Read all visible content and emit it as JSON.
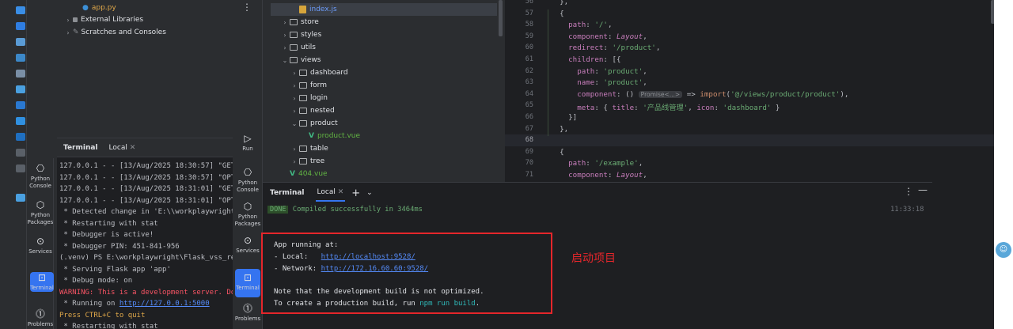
{
  "project_tree_top": {
    "app_file": "app.py",
    "external_libraries": "External Libraries",
    "scratches": "Scratches and Consoles"
  },
  "left_terminal": {
    "title": "Terminal",
    "tab": "Local",
    "lines": [
      {
        "text": "127.0.0.1 - - [13/Aug/2025 18:30:57] \"GET",
        "cls": ""
      },
      {
        "text": "127.0.0.1 - - [13/Aug/2025 18:30:57] \"OPT",
        "cls": ""
      },
      {
        "text": "127.0.0.1 - - [13/Aug/2025 18:31:01] \"GET",
        "cls": ""
      },
      {
        "text": "127.0.0.1 - - [13/Aug/2025 18:31:01] \"OPT",
        "cls": ""
      },
      {
        "text": " * Detected change in 'E:\\\\workplaywright",
        "cls": ""
      },
      {
        "text": " * Restarting with stat",
        "cls": ""
      },
      {
        "text": " * Debugger is active!",
        "cls": ""
      },
      {
        "text": " * Debugger PIN: 451-841-956",
        "cls": ""
      },
      {
        "text": "(.venv) PS E:\\workplaywright\\Flask_vss_re",
        "cls": ""
      },
      {
        "text": " * Serving Flask app 'app'",
        "cls": ""
      },
      {
        "text": " * Debug mode: on",
        "cls": ""
      },
      {
        "text": "WARNING: This is a development server. Do",
        "cls": "red"
      },
      {
        "text": " * Running on http://127.0.0.1:5000",
        "cls": ""
      },
      {
        "text": "Press CTRL+C to quit",
        "cls": "org"
      },
      {
        "text": " * Restarting with stat",
        "cls": ""
      }
    ]
  },
  "left_strip": [
    {
      "label": "Python Console",
      "icon": "python-console-icon"
    },
    {
      "label": "Python Packages",
      "icon": "packages-icon"
    },
    {
      "label": "Services",
      "icon": "services-icon"
    },
    {
      "label": "Terminal",
      "icon": "terminal-icon"
    },
    {
      "label": "Problems",
      "icon": "problems-icon"
    }
  ],
  "mid_strip": [
    {
      "label": "Run",
      "icon": "run-icon"
    },
    {
      "label": "Python Console",
      "icon": "python-console-icon"
    },
    {
      "label": "Python Packages",
      "icon": "packages-icon"
    },
    {
      "label": "Services",
      "icon": "services-icon"
    },
    {
      "label": "Terminal",
      "icon": "terminal-icon"
    },
    {
      "label": "Problems",
      "icon": "problems-icon"
    }
  ],
  "file_tree": [
    {
      "name": "index.js",
      "type": "js",
      "indent": 3,
      "arrow": "",
      "selected": true
    },
    {
      "name": "store",
      "type": "folder",
      "indent": 2,
      "arrow": "›",
      "selected": false
    },
    {
      "name": "styles",
      "type": "folder",
      "indent": 2,
      "arrow": "›",
      "selected": false
    },
    {
      "name": "utils",
      "type": "folder",
      "indent": 2,
      "arrow": "›",
      "selected": false
    },
    {
      "name": "views",
      "type": "folder",
      "indent": 2,
      "arrow": "⌄",
      "selected": false
    },
    {
      "name": "dashboard",
      "type": "folder",
      "indent": 3,
      "arrow": "›",
      "selected": false
    },
    {
      "name": "form",
      "type": "folder",
      "indent": 3,
      "arrow": "›",
      "selected": false
    },
    {
      "name": "login",
      "type": "folder",
      "indent": 3,
      "arrow": "›",
      "selected": false
    },
    {
      "name": "nested",
      "type": "folder",
      "indent": 3,
      "arrow": "›",
      "selected": false
    },
    {
      "name": "product",
      "type": "folder",
      "indent": 3,
      "arrow": "⌄",
      "selected": false
    },
    {
      "name": "product.vue",
      "type": "vue",
      "indent": 4,
      "arrow": "",
      "selected": false
    },
    {
      "name": "table",
      "type": "folder",
      "indent": 3,
      "arrow": "›",
      "selected": false
    },
    {
      "name": "tree",
      "type": "folder",
      "indent": 3,
      "arrow": "›",
      "selected": false
    },
    {
      "name": "404.vue",
      "type": "vue",
      "indent": 2,
      "arrow": "",
      "selected": false
    }
  ],
  "editor": {
    "line_numbers": [
      "56",
      "57",
      "58",
      "59",
      "60",
      "61",
      "62",
      "63",
      "64",
      "65",
      "66",
      "67",
      "68",
      "69",
      "70",
      "71"
    ],
    "lines": [
      "  },",
      "  {",
      "    path: '/',",
      "    component: Layout,",
      "    redirect: '/product',",
      "    children: [{",
      "      path: 'product',",
      "      name: 'product',",
      "      component: () ",
      "      meta: { title: '产品线管理', icon: 'dashboard' }",
      "    }]",
      "  },",
      "",
      "  {",
      "    path: '/example',",
      "    component: Layout,"
    ],
    "hint": "Promise<...>",
    "hint_after": " => import('@/views/product/product'),"
  },
  "bottom_terminal": {
    "title": "Terminal",
    "tab": "Local",
    "done_badge": "DONE",
    "compiled": "Compiled successfully in 3464ms",
    "time": "11:33:18",
    "app_running": "App running at:",
    "local_label": "- Local:   ",
    "local_url": "http://localhost:9528/",
    "network_label": "- Network: ",
    "network_url": "http://172.16.60.60:9528/",
    "note": "Note that the development build is not optimized.",
    "prod_prefix": "To create a production build, run ",
    "prod_cmd": "npm run build",
    "prod_suffix": "."
  },
  "annotation": "启动项目"
}
